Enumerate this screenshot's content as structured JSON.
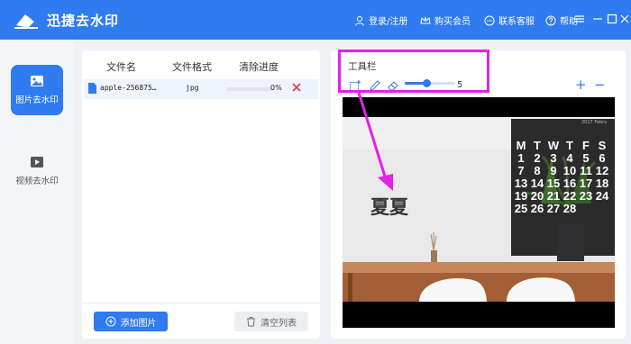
{
  "app": {
    "title": "迅捷去水印"
  },
  "header": {
    "login": "登录/注册",
    "buy": "购买会员",
    "service": "联系客服",
    "help": "帮助"
  },
  "nav": {
    "items": [
      {
        "label": "图片去水印",
        "icon": "image-icon",
        "active": true
      },
      {
        "label": "视频去水印",
        "icon": "video-play-icon",
        "active": false
      }
    ]
  },
  "files": {
    "columns": [
      "文件名",
      "文件格式",
      "清除进度"
    ],
    "rows": [
      {
        "name": "apple-256875…",
        "format": "jpg",
        "progress_text": "0%",
        "progress": 0
      }
    ],
    "add_label": "添加图片",
    "clear_label": "清空列表"
  },
  "toolbar": {
    "title": "工具栏",
    "brush_size": "5",
    "zoom_in": "+",
    "zoom_out": "−",
    "tools": [
      "select-rect-icon",
      "pen-icon",
      "eraser-icon"
    ]
  },
  "preview": {
    "watermark_text": "夏夏",
    "calendar_header": "2017   Febru",
    "calendar_days": [
      "M",
      "T",
      "W",
      "T",
      "F",
      "S"
    ],
    "calendar_numbers": [
      "1",
      "2",
      "3",
      "4",
      "5",
      "6",
      "7",
      "8",
      "9",
      "10",
      "11",
      "12",
      "13",
      "14",
      "15",
      "16",
      "17",
      "18",
      "19",
      "20",
      "21",
      "22",
      "23",
      "24",
      "25",
      "26",
      "27",
      "28"
    ]
  },
  "colors": {
    "primary": "#2f7bef",
    "highlight": "#e321e8",
    "delete": "#e33b3b"
  }
}
